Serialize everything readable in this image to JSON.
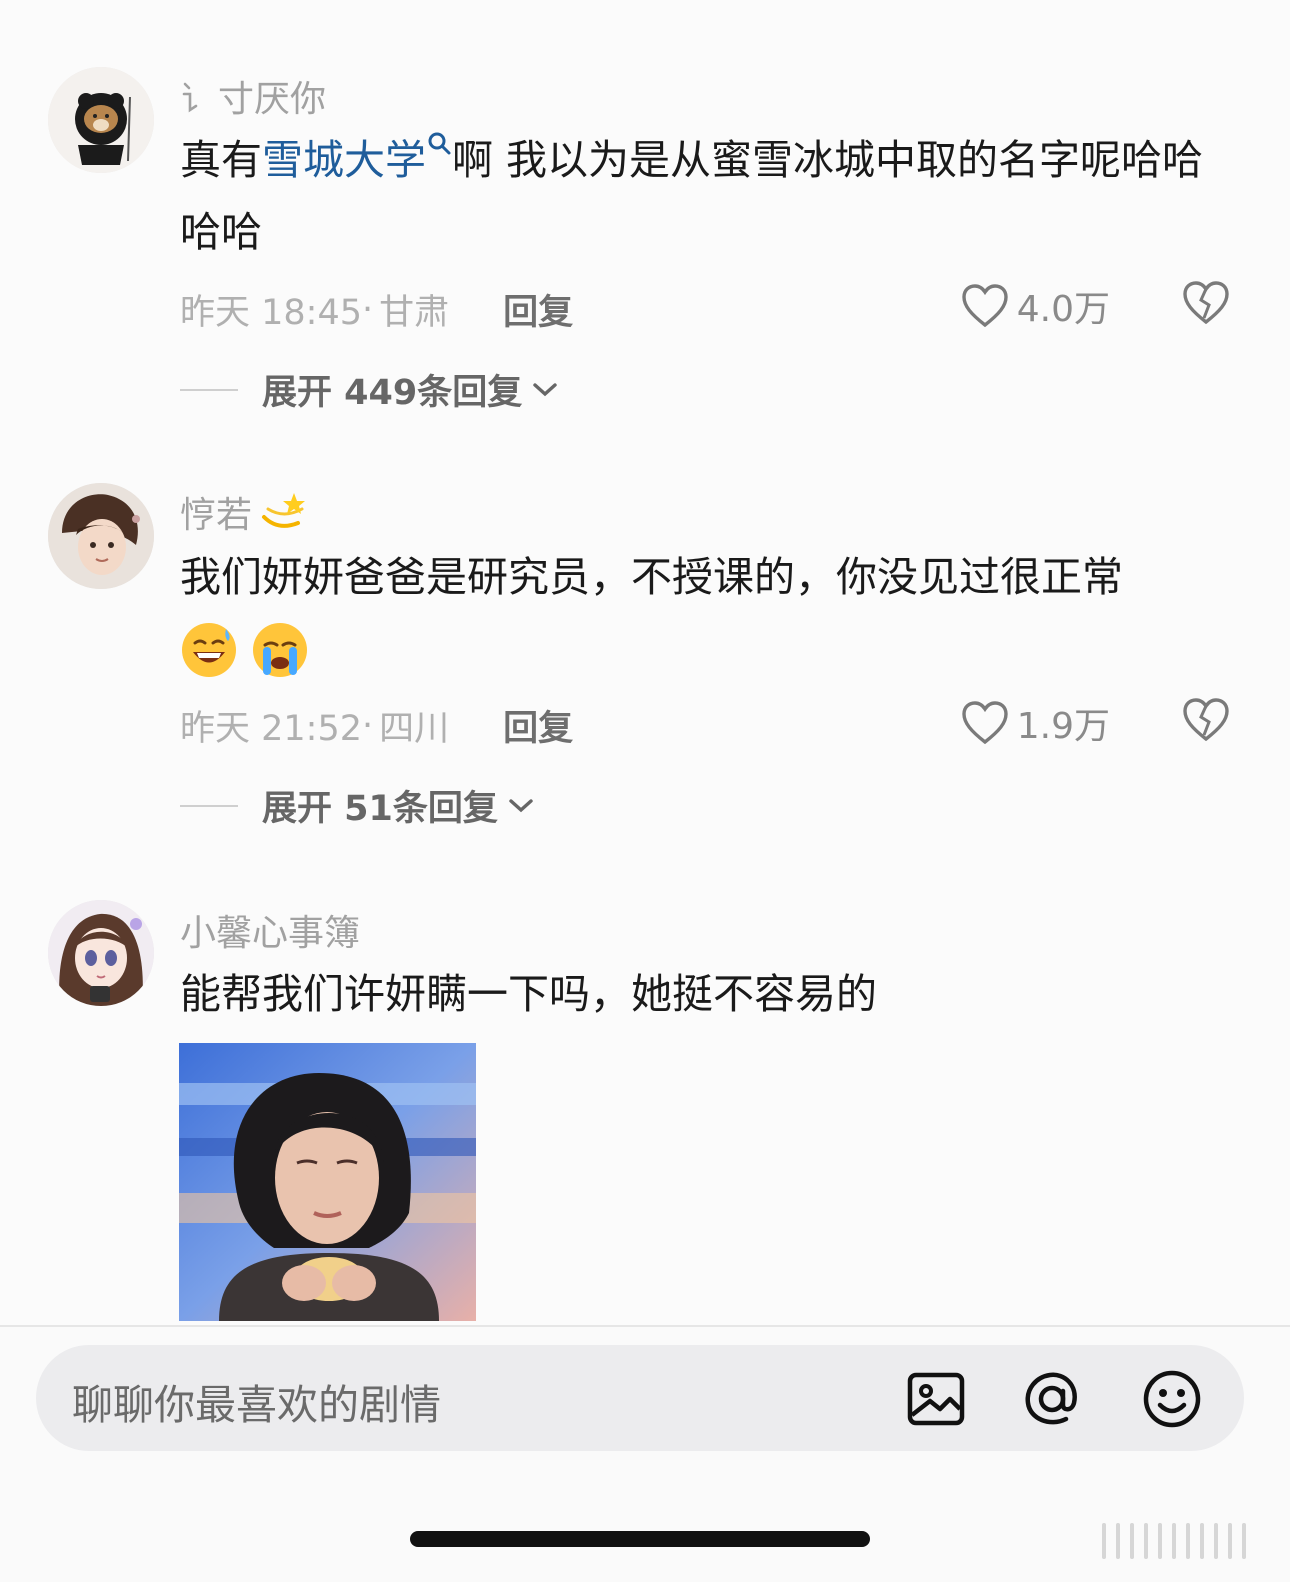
{
  "comments": [
    {
      "username": "寸厌你",
      "username_prefix_icon": "pen-icon",
      "text_before": "真有",
      "link_text": "雪城大学",
      "text_after": "啊 我以为是从蜜雪冰城中取的名字呢哈哈哈哈",
      "time": "昨天 18:45",
      "location": "甘肃",
      "reply_label": "回复",
      "likes": "4.0万",
      "expand_label": "展开 449条回复"
    },
    {
      "username": "悙若",
      "username_suffix_icon": "dizzy-star-emoji",
      "text": "我们妍妍爸爸是研究员，不授课的，你没见过很正常",
      "emojis": [
        "grinning-sweat-emoji",
        "crying-emoji"
      ],
      "time": "昨天 21:52",
      "location": "四川",
      "reply_label": "回复",
      "likes": "1.9万",
      "expand_label": "展开 51条回复"
    },
    {
      "username": "小馨心事簿",
      "text": "能帮我们许妍瞒一下吗，她挺不容易的",
      "image": "gif-woman-eating"
    }
  ],
  "composer": {
    "placeholder": "聊聊你最喜欢的剧情",
    "icons": [
      "image-icon",
      "at-icon",
      "emoji-icon"
    ]
  },
  "colors": {
    "link": "#1f5d9b",
    "muted": "#a1a1a1",
    "background": "#fbfbfb"
  }
}
